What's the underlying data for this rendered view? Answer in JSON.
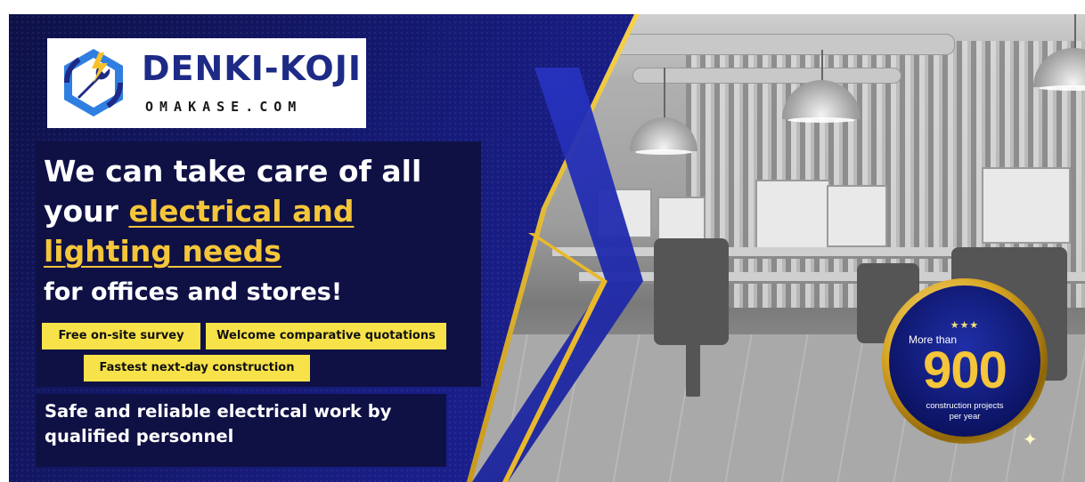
{
  "logo": {
    "title": "DENKI-KOJI",
    "subtitle": "OMAKASE.COM",
    "colors": {
      "navy": "#1d2a86",
      "blue": "#2f7fe0",
      "yellow": "#f6c12a"
    }
  },
  "headline": {
    "line1": "We can take care of all",
    "line2_prefix": "your ",
    "highlight_a": "electrical and",
    "highlight_b": "lighting needs",
    "line4": "for offices and stores!"
  },
  "tags": {
    "survey": "Free on-site survey",
    "quotes": "Welcome comparative quotations",
    "construction": "Fastest next-day construction"
  },
  "subline": "Safe and reliable electrical work by qualified personnel",
  "badge": {
    "stars": "★★★",
    "prefix": "More than",
    "number": "900",
    "suffix": "construction projects per year"
  },
  "theme": {
    "navy": "#0f1145",
    "accent_gold": "#f5c53a",
    "tag_yellow": "#f7e24a"
  }
}
